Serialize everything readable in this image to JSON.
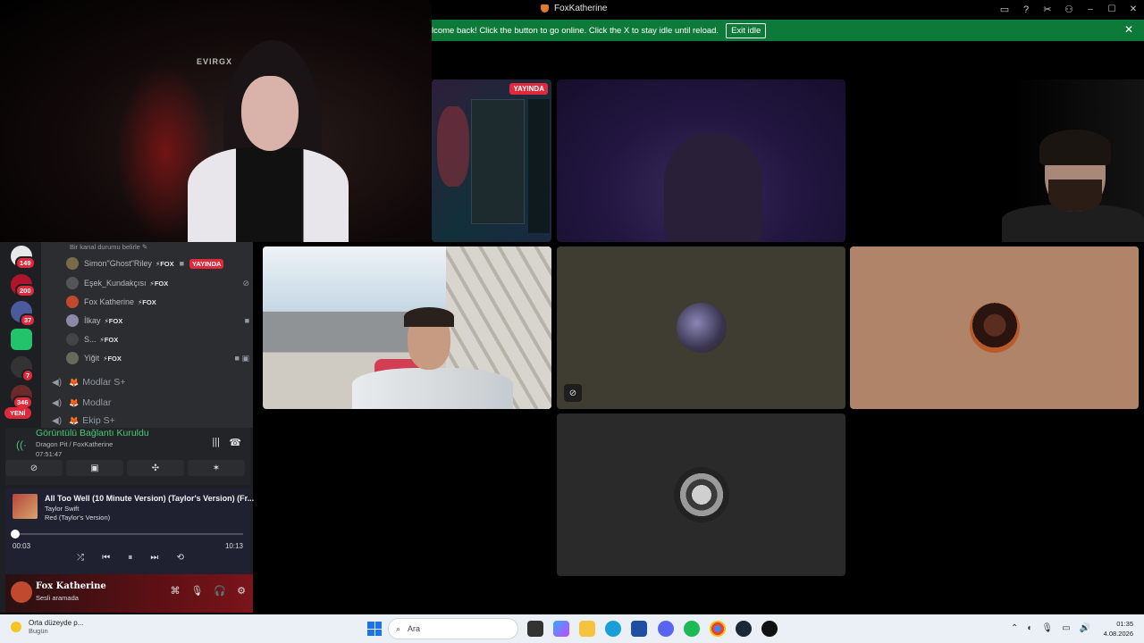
{
  "window": {
    "title": "FoxKatherine",
    "icons": [
      "inbox-icon",
      "help-icon",
      "tools-icon",
      "profile-icon"
    ],
    "controls": {
      "minimize": "–",
      "maximize": "☐",
      "close": "✕"
    }
  },
  "banner": {
    "message": "lcome back! Click the button to go online. Click the X to stay idle until reload.",
    "button": "Exit idle",
    "close": "✕"
  },
  "video": {
    "main_cam_logo": "EVIRGX",
    "screen_share_badge": "YAYINDA"
  },
  "servers": {
    "badges": [
      "149",
      "200",
      "37",
      "7",
      "346"
    ],
    "new_label": "YENİ"
  },
  "channel": {
    "status_hint": "Bir kanal durumu belirle ✎",
    "members": [
      {
        "name": "Simon\"Ghost\"Riley",
        "tag": "⚡FOX",
        "live": "YAYINDA",
        "icon": "video-icon"
      },
      {
        "name": "Eşek_Kundakçısı",
        "tag": "⚡FOX",
        "icon": "mute-icon"
      },
      {
        "name": "Fox Katherine",
        "tag": "⚡FOX"
      },
      {
        "name": "İlkay",
        "tag": "⚡FOX",
        "icon": "video-icon"
      },
      {
        "name": "S...",
        "tag": "⚡FOX"
      },
      {
        "name": "Yiğit",
        "tag": "⚡FOX",
        "icon": "video-icon"
      }
    ],
    "voice_channels": [
      "Modlar S+",
      "Modlar",
      "Ekip S+"
    ]
  },
  "voice_panel": {
    "status": "Görüntülü Bağlantı Kuruldu",
    "location": "Dragon Pit / FoxKatherine",
    "elapsed": "07:51:47"
  },
  "music": {
    "title": "All Too Well (10 Minute Version) (Taylor's Version) (Fr...",
    "artist": "Taylor Swift",
    "album": "Red (Taylor's Version)",
    "current": "00:03",
    "duration": "10:13",
    "progress": 0.005
  },
  "user": {
    "name": "Fox Katherine",
    "status": "Sesli aramada"
  },
  "taskbar": {
    "weather_title": "Orta düzeyde p...",
    "weather_sub": "Bugün",
    "search_placeholder": "Ara",
    "time": "01:35",
    "date": "4.08.2026"
  },
  "colors": {
    "banner": "#0e7a3a",
    "live": "#e02a3b",
    "connected": "#49c978",
    "discord_bg": "#2b2d31"
  }
}
